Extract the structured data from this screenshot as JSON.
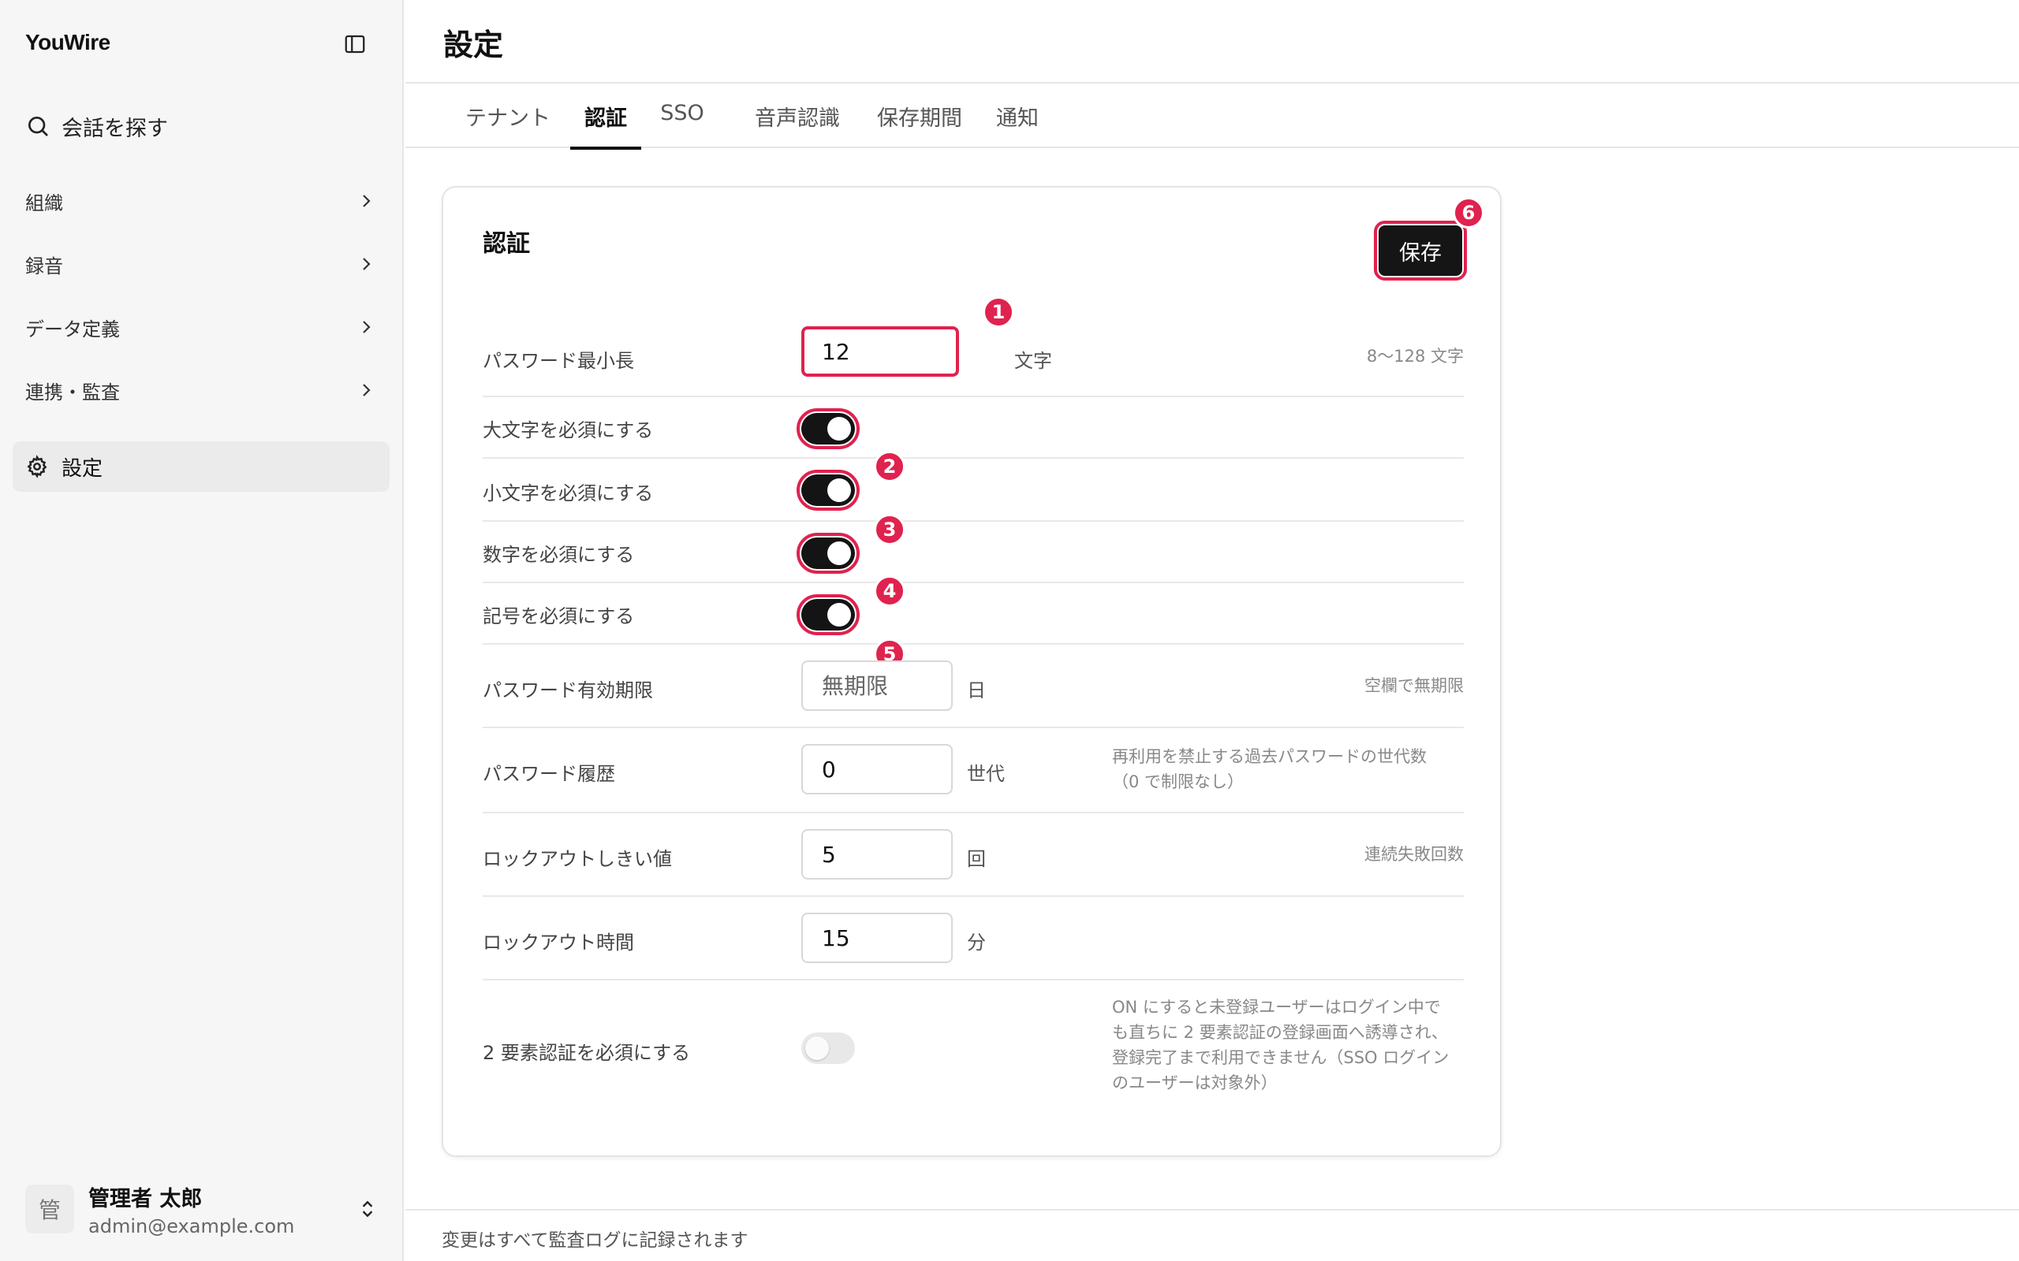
{
  "sidebar": {
    "brand": "YouWire",
    "search_label": "会話を探す",
    "items": [
      {
        "label": "組織"
      },
      {
        "label": "録音"
      },
      {
        "label": "データ定義"
      },
      {
        "label": "連携・監査"
      }
    ],
    "settings_label": "設定",
    "user": {
      "avatar_text": "管",
      "name": "管理者 太郎",
      "email": "admin@example.com"
    }
  },
  "header": {
    "title": "設定"
  },
  "tabs": [
    {
      "label": "テナント",
      "active": false
    },
    {
      "label": "認証",
      "active": true
    },
    {
      "label": "SSO",
      "active": false
    },
    {
      "label": "音声認識",
      "active": false
    },
    {
      "label": "保存期間",
      "active": false
    },
    {
      "label": "通知",
      "active": false
    }
  ],
  "card": {
    "title": "認証",
    "save_label": "保存",
    "password_min_length": {
      "label": "パスワード最小長",
      "value": "12",
      "unit": "文字",
      "hint": "8〜128 文字"
    },
    "require_uppercase": {
      "label": "大文字を必須にする",
      "on": true
    },
    "require_lowercase": {
      "label": "小文字を必須にする",
      "on": true
    },
    "require_digits": {
      "label": "数字を必須にする",
      "on": true
    },
    "require_symbols": {
      "label": "記号を必須にする",
      "on": true
    },
    "password_expiry": {
      "label": "パスワード有効期限",
      "placeholder": "無期限",
      "unit": "日",
      "hint": "空欄で無期限"
    },
    "password_history": {
      "label": "パスワード履歴",
      "value": "0",
      "unit": "世代",
      "hint_line1": "再利用を禁止する過去パスワードの世代数",
      "hint_line2": "（0 で制限なし）"
    },
    "lockout_threshold": {
      "label": "ロックアウトしきい値",
      "value": "5",
      "unit": "回",
      "hint": "連続失敗回数"
    },
    "lockout_duration": {
      "label": "ロックアウト時間",
      "value": "15",
      "unit": "分"
    },
    "require_2fa": {
      "label": "2 要素認証を必須にする",
      "on": false,
      "hint_lines": [
        "ON にすると未登録ユーザーはログイン中で",
        "も直ちに 2 要素認証の登録画面へ誘導され、",
        "登録完了まで利用できません（SSO ログイン",
        "のユーザーは対象外）"
      ]
    }
  },
  "badges": [
    "1",
    "2",
    "3",
    "4",
    "5",
    "6"
  ],
  "footer": {
    "text": "変更はすべて監査ログに記録されます"
  },
  "colors": {
    "accent_highlight": "#e0224e",
    "toggle_on": "#141414",
    "toggle_off": "#e8e8e8"
  }
}
